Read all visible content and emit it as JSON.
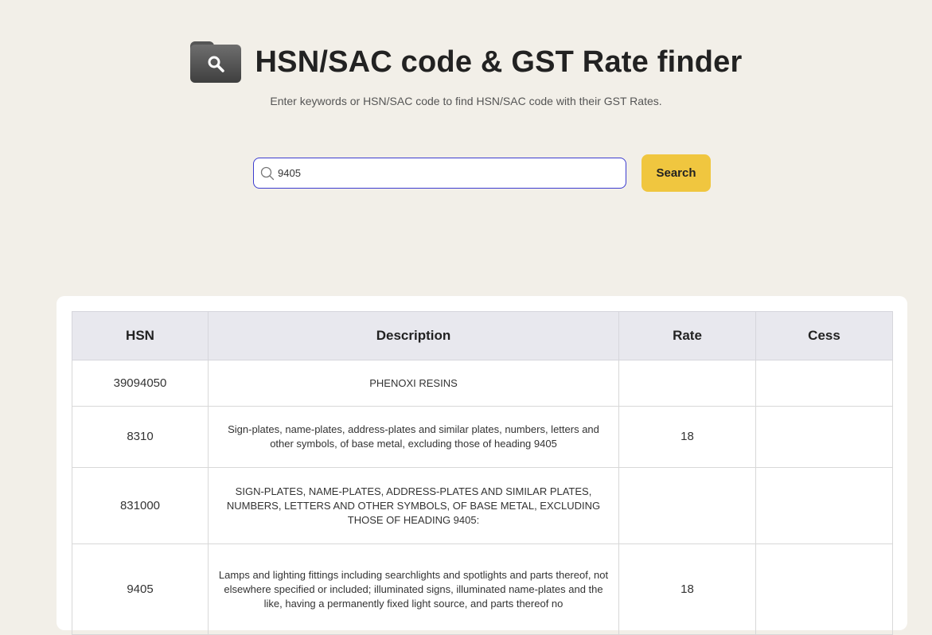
{
  "header": {
    "title": "HSN/SAC code & GST Rate finder",
    "subtitle": "Enter keywords or HSN/SAC code to find HSN/SAC code with their GST Rates."
  },
  "search": {
    "value": "9405",
    "button_label": "Search"
  },
  "table": {
    "columns": [
      "HSN",
      "Description",
      "Rate",
      "Cess"
    ],
    "rows": [
      {
        "hsn": "39094050",
        "description": "PHENOXI RESINS",
        "rate": "",
        "cess": ""
      },
      {
        "hsn": "8310",
        "description": "Sign-plates, name-plates, address-plates and similar plates, numbers, letters and other symbols, of base metal, excluding those of heading 9405",
        "rate": "18",
        "cess": ""
      },
      {
        "hsn": "831000",
        "description": "SIGN-PLATES, NAME-PLATES, ADDRESS-PLATES AND SIMILAR PLATES, NUMBERS, LETTERS AND OTHER SYMBOLS, OF BASE METAL, EXCLUDING THOSE OF HEADING 9405:",
        "rate": "",
        "cess": ""
      },
      {
        "hsn": "9405",
        "description": "Lamps and lighting fittings including searchlights and spotlights and parts thereof, not elsewhere specified or included; illuminated signs, illuminated name-plates and the like, having a permanently fixed light source, and parts thereof no",
        "rate": "18",
        "cess": ""
      }
    ]
  },
  "colors": {
    "background": "#f2efe8",
    "accent": "#f0c63f",
    "input_border": "#3c3ccf"
  }
}
